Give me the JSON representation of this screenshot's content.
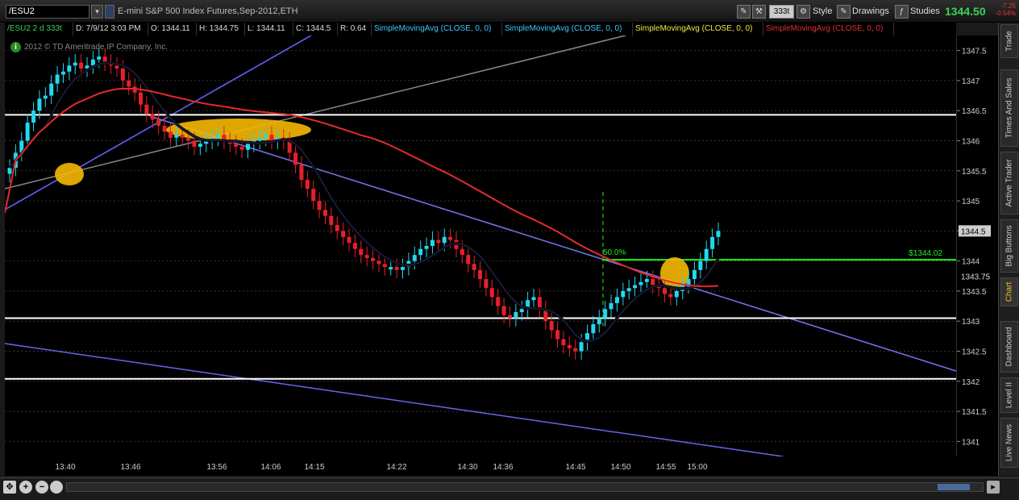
{
  "toolbar": {
    "symbol": "/ESU2",
    "description": "E-mini S&P 500 Index Futures,Sep-2012,ETH",
    "aggregation": "333t",
    "style_label": "Style",
    "drawings_label": "Drawings",
    "studies_label": "Studies",
    "last_price": "1344.50",
    "net_change": "-7.25",
    "net_change_pct": "-0.54%"
  },
  "header": {
    "symbol_period": "/ESU2 2 d 333t",
    "date": "D: 7/9/12 3:03 PM",
    "open": "O: 1344.11",
    "high": "H: 1344.75",
    "low": "L: 1344.11",
    "close": "C: 1344.5",
    "range": "R: 0.64",
    "studies": [
      {
        "label": "SimpleMovingAvg (CLOSE, 0, 0)",
        "color": "#3ec8ff"
      },
      {
        "label": "SimpleMovingAvg (CLOSE, 0, 0)",
        "color": "#3ec8ff"
      },
      {
        "label": "SimpleMovingAvg (CLOSE, 0, 0)",
        "color": "#f5e642"
      },
      {
        "label": "SimpleMovingAvg (CLOSE, 0, 0)",
        "color": "#e03030"
      }
    ]
  },
  "copyright": "2012 © TD Ameritrade IP Company, Inc.",
  "sidetabs": [
    "Trade",
    "Times And Sales",
    "Active Trader",
    "Big Buttons",
    "Chart",
    "Dashboard",
    "Level II",
    "Live News"
  ],
  "chart_data": {
    "type": "candlestick",
    "price_range": [
      1340.75,
      1347.75
    ],
    "y_ticks": [
      "1347.5",
      "1347",
      "1346.5",
      "1346",
      "1345.5",
      "1345",
      "1344.5",
      "1344",
      "1343.5",
      "1343",
      "1342.5",
      "1342",
      "1341.5",
      "1341"
    ],
    "x_ticks": [
      "13:40",
      "13:46",
      "13:56",
      "14:06",
      "14:15",
      "14:22",
      "14:30",
      "14:36",
      "14:45",
      "14:50",
      "14:55",
      "15:00"
    ],
    "price_labels": {
      "last": "1344.5",
      "ma": "1343.75"
    },
    "horizontal_lines": [
      {
        "price": 1346.43,
        "color": "#ffffff"
      },
      {
        "price": 1343.05,
        "color": "#ffffff"
      },
      {
        "price": 1342.04,
        "color": "#ffffff"
      },
      {
        "price": 1344.02,
        "color": "#22ee22",
        "label": "$1344.02"
      }
    ],
    "fib_label": "50.0%",
    "closes": [
      1345.55,
      1345.8,
      1346.0,
      1346.3,
      1346.5,
      1346.7,
      1346.75,
      1346.95,
      1347.1,
      1347.15,
      1347.25,
      1347.3,
      1347.2,
      1347.25,
      1347.35,
      1347.4,
      1347.3,
      1347.25,
      1347.2,
      1347.0,
      1346.9,
      1346.8,
      1346.6,
      1346.45,
      1346.35,
      1346.25,
      1346.15,
      1346.05,
      1346.1,
      1346.05,
      1346.0,
      1345.9,
      1345.95,
      1346.0,
      1346.05,
      1346.1,
      1346.0,
      1345.95,
      1345.9,
      1345.85,
      1345.95,
      1346.0,
      1346.05,
      1346.1,
      1346.0,
      1346.05,
      1346.0,
      1345.8,
      1345.6,
      1345.35,
      1345.2,
      1345.0,
      1344.85,
      1344.75,
      1344.6,
      1344.5,
      1344.4,
      1344.3,
      1344.2,
      1344.1,
      1344.05,
      1344.0,
      1343.95,
      1343.9,
      1343.9,
      1343.85,
      1343.9,
      1344.0,
      1344.1,
      1344.2,
      1344.25,
      1344.35,
      1344.3,
      1344.4,
      1344.35,
      1344.2,
      1344.1,
      1343.95,
      1343.85,
      1343.7,
      1343.55,
      1343.4,
      1343.25,
      1343.1,
      1343.05,
      1343.15,
      1343.2,
      1343.35,
      1343.4,
      1343.2,
      1343.0,
      1342.85,
      1342.7,
      1342.6,
      1342.55,
      1342.5,
      1342.65,
      1342.8,
      1342.95,
      1343.05,
      1343.2,
      1343.3,
      1343.4,
      1343.5,
      1343.55,
      1343.6,
      1343.65,
      1343.7,
      1343.6,
      1343.55,
      1343.45,
      1343.4,
      1343.5,
      1343.6,
      1343.7,
      1343.85,
      1344.0,
      1344.2,
      1344.4,
      1344.5
    ]
  }
}
